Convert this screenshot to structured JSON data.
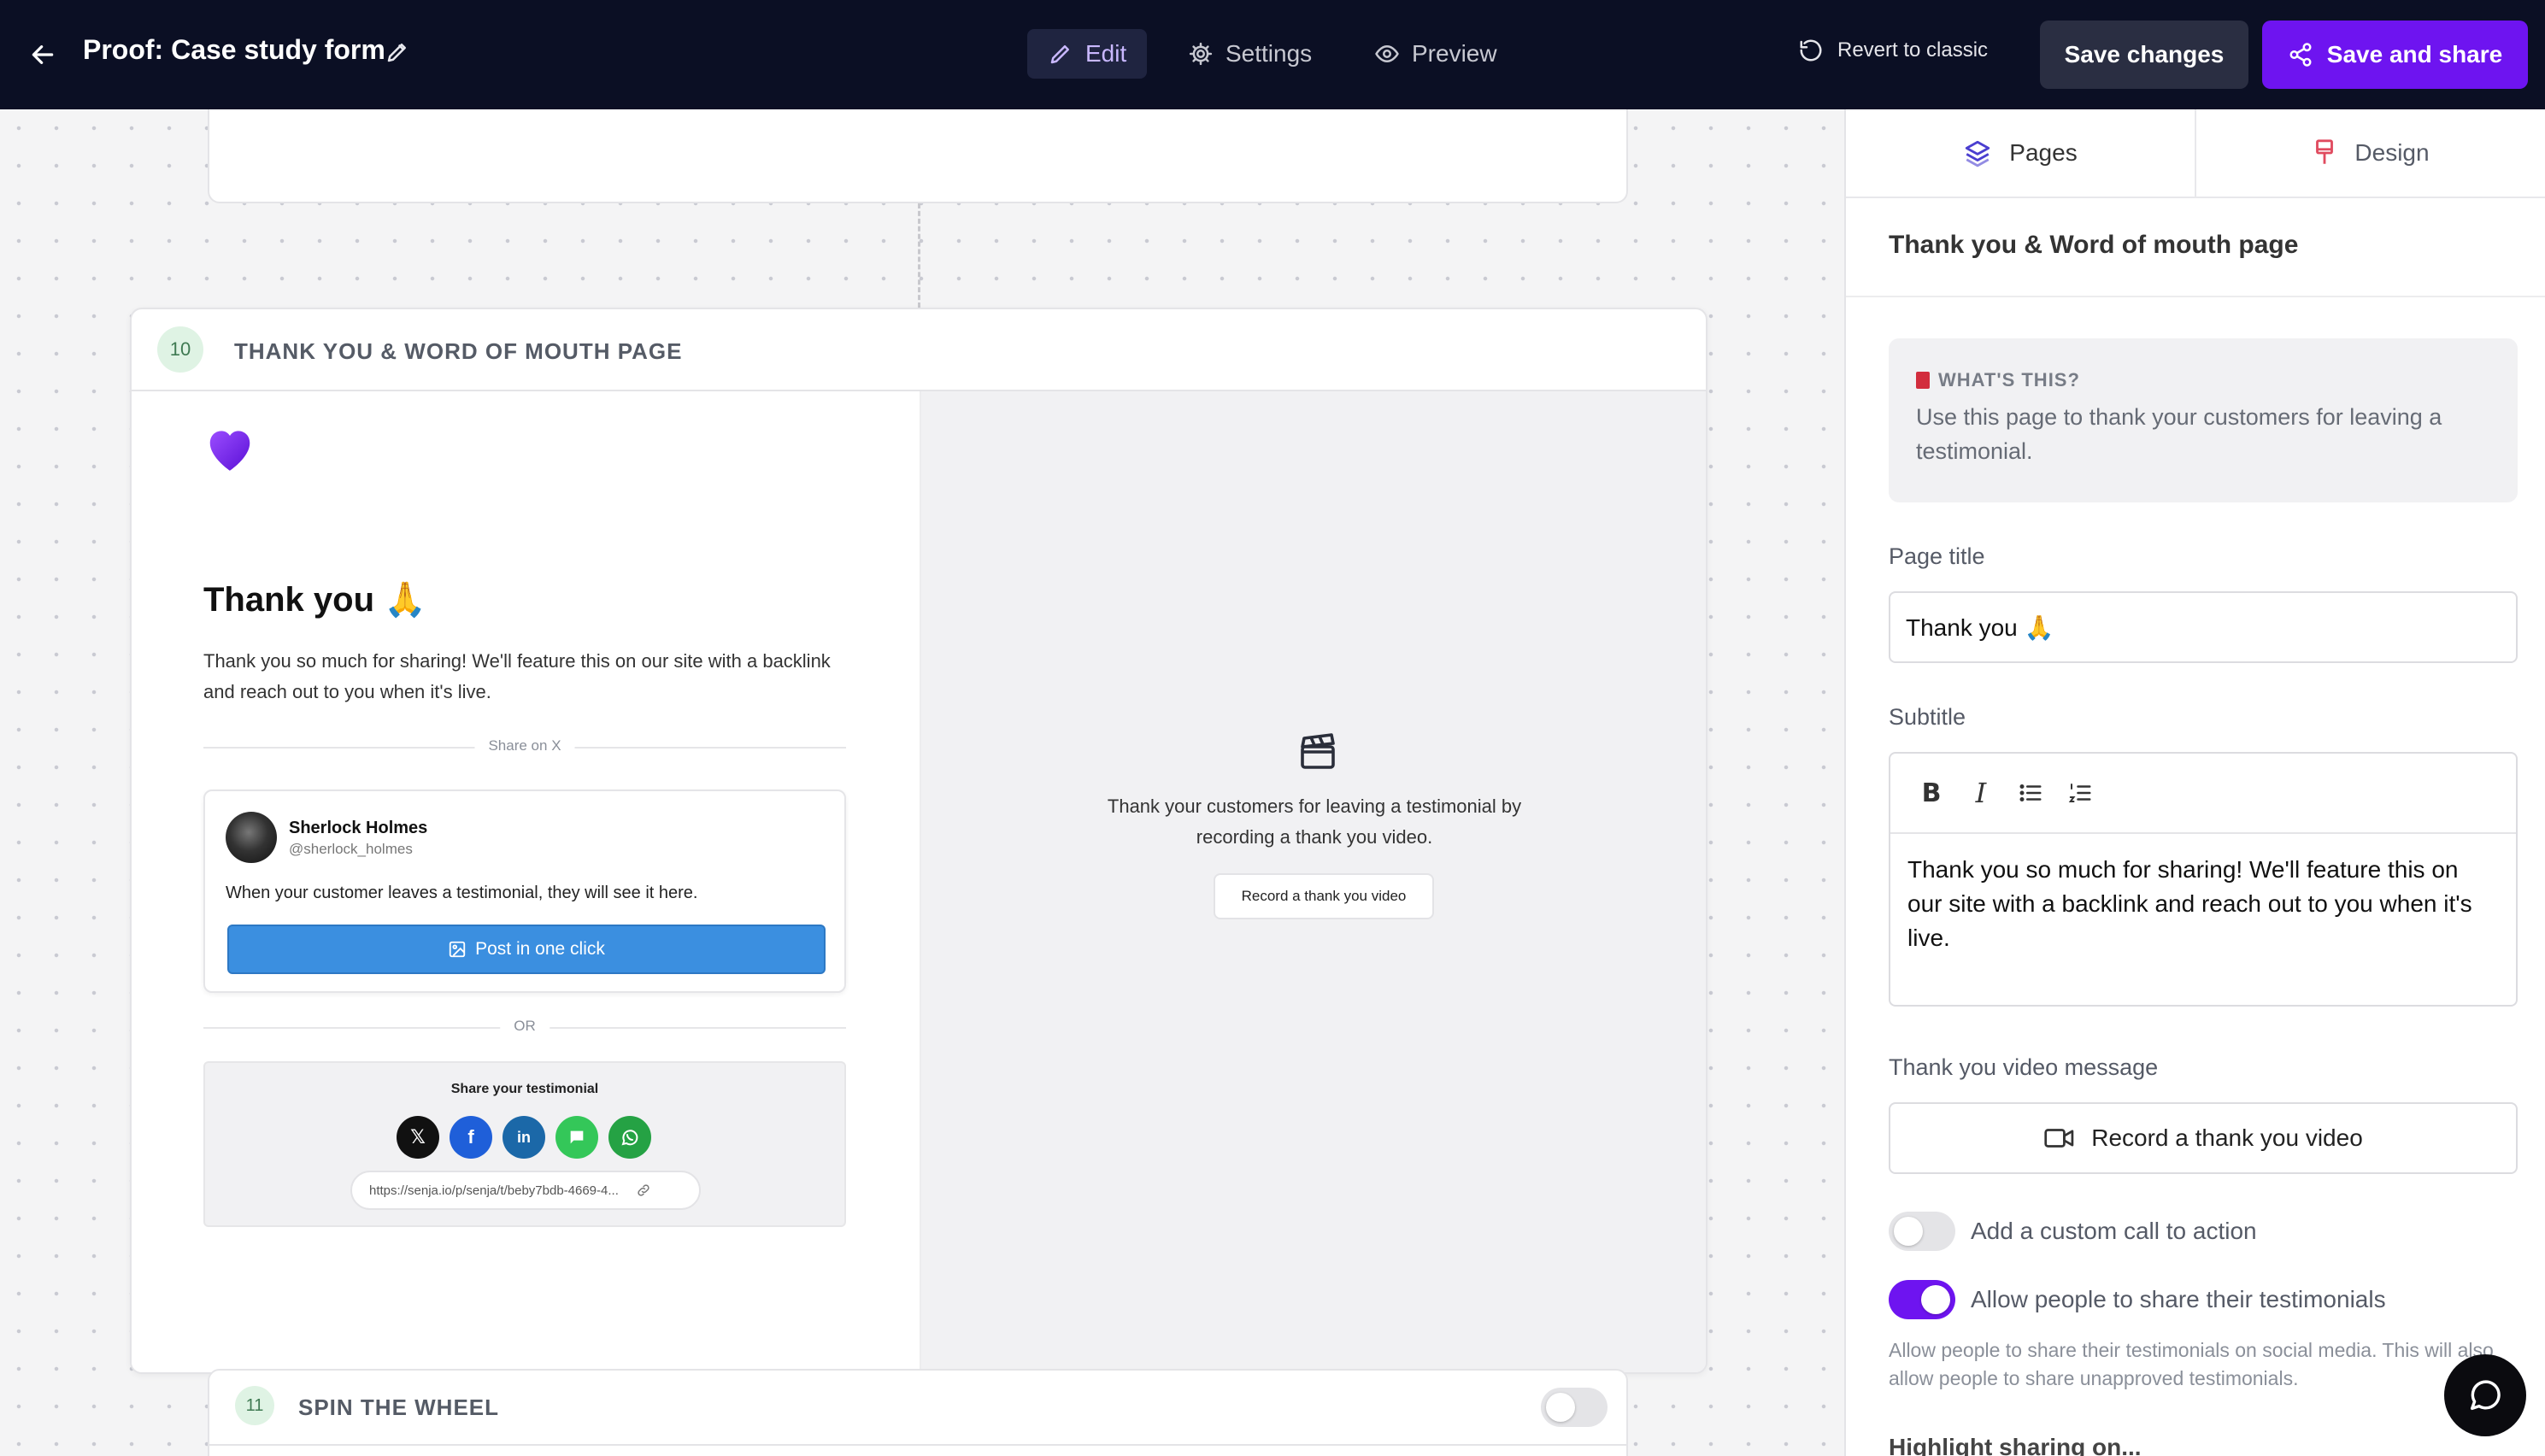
{
  "topbar": {
    "title": "Proof: Case study form",
    "nav": {
      "edit": "Edit",
      "settings": "Settings",
      "preview": "Preview"
    },
    "revert": "Revert to classic",
    "save_changes": "Save changes",
    "save_and_share": "Save and share"
  },
  "canvas": {
    "section10": {
      "number": "10",
      "title": "THANK YOU & WORD OF MOUTH PAGE",
      "page_title": "Thank you 🙏",
      "subtitle": "Thank you so much for sharing! We'll feature this on our site with a backlink and reach out to you when it's live.",
      "share_on_x": "Share on X",
      "tweet": {
        "name": "Sherlock Holmes",
        "handle": "@sherlock_holmes",
        "text": "When your customer leaves a testimonial, they will see it here.",
        "button": "Post in one click"
      },
      "or": "OR",
      "share_box": {
        "title": "Share your testimonial",
        "url": "https://senja.io/p/senja/t/beby7bdb-4669-4..."
      },
      "video": {
        "text": "Thank your customers for leaving a testimonial by recording a thank you video.",
        "button": "Record a thank you video"
      }
    },
    "section11": {
      "number": "11",
      "title": "SPIN THE WHEEL",
      "enabled": false
    }
  },
  "panel": {
    "tabs": {
      "pages": "Pages",
      "design": "Design"
    },
    "title": "Thank you & Word of mouth page",
    "info": {
      "heading": "WHAT'S THIS?",
      "body": "Use this page to thank your customers for leaving a testimonial."
    },
    "page_title_label": "Page title",
    "page_title_value": "Thank you 🙏",
    "subtitle_label": "Subtitle",
    "subtitle_value": "Thank you so much for sharing! We'll feature this on our site with a backlink and reach out to you when it's live.",
    "video_label": "Thank you video message",
    "video_button": "Record a thank you video",
    "cta_label": "Add a custom call to action",
    "cta_enabled": false,
    "share_label": "Allow people to share their testimonials",
    "share_enabled": true,
    "share_help": "Allow people to share their testimonials on social media. This will also allow people to share unapproved testimonials.",
    "highlight_label": "Highlight sharing on..."
  },
  "colors": {
    "brand": "#6e14f0",
    "topbar": "#0b0f24",
    "x_blue": "#3b8fe0"
  }
}
